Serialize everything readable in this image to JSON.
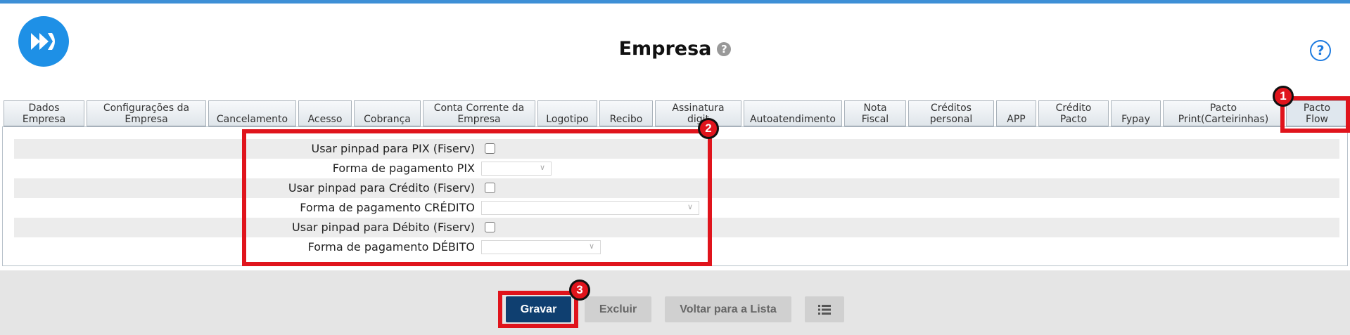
{
  "header": {
    "title": "Empresa",
    "title_help": "?",
    "help_button": "?"
  },
  "tabs": [
    {
      "label": "Dados\nEmpresa"
    },
    {
      "label": "Configurações da\nEmpresa"
    },
    {
      "label": "Cancelamento"
    },
    {
      "label": "Acesso"
    },
    {
      "label": "Cobrança"
    },
    {
      "label": "Conta Corrente da\nEmpresa"
    },
    {
      "label": "Logotipo"
    },
    {
      "label": "Recibo"
    },
    {
      "label": "Assinatura\ndigit"
    },
    {
      "label": "Autoatendimento"
    },
    {
      "label": "Nota\nFiscal"
    },
    {
      "label": "Créditos\npersonal"
    },
    {
      "label": "APP"
    },
    {
      "label": "Crédito\nPacto"
    },
    {
      "label": "Fypay"
    },
    {
      "label": "Pacto\nPrint(Carteirinhas)"
    },
    {
      "label": "Pacto\nFlow"
    }
  ],
  "form": {
    "rows": [
      {
        "label": "Usar pinpad para PIX (Fiserv)",
        "type": "checkbox",
        "checked": false
      },
      {
        "label": "Forma de pagamento PIX",
        "type": "select",
        "value": ""
      },
      {
        "label": "Usar pinpad para Crédito (Fiserv)",
        "type": "checkbox",
        "checked": false
      },
      {
        "label": "Forma de pagamento CRÉDITO",
        "type": "select",
        "value": ""
      },
      {
        "label": "Usar pinpad para Débito (Fiserv)",
        "type": "checkbox",
        "checked": false
      },
      {
        "label": "Forma de pagamento DÉBITO",
        "type": "select",
        "value": ""
      }
    ]
  },
  "actions": {
    "save": "Gravar",
    "delete": "Excluir",
    "back": "Voltar para a Lista",
    "list_icon": "list-icon"
  },
  "annotations": {
    "badge1": "1",
    "badge2": "2",
    "badge3": "3",
    "color": "#e0141c"
  },
  "colors": {
    "accent": "#1e90e6",
    "primary_button": "#0f3f70"
  }
}
